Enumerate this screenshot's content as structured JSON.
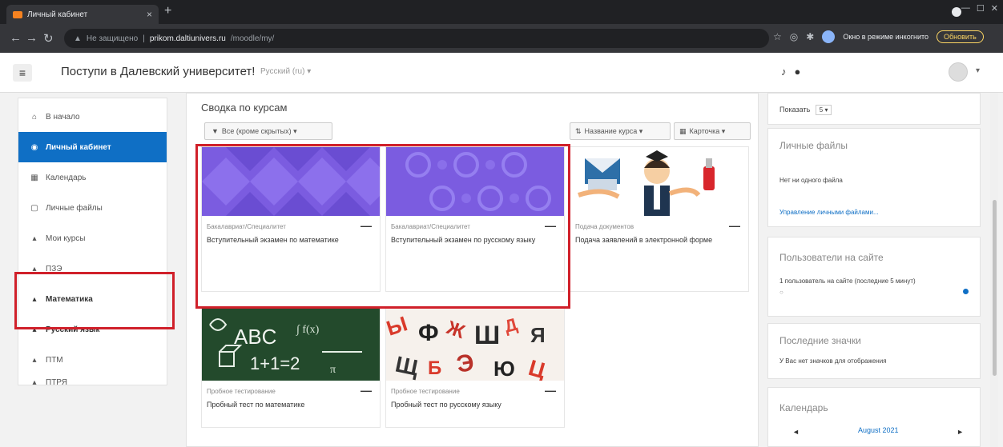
{
  "browser": {
    "tab_title": "Личный кабинет",
    "tab_close": "×",
    "new_tab": "+",
    "insecure_label": "Не защищено",
    "url_host": "prikom.daltiunivers.ru",
    "url_path": "/moodle/my/",
    "update_label": "Обновить",
    "profile_label": "Окно в режиме инкогнито"
  },
  "navbar": {
    "site_name": "Поступи в Далевский университет!",
    "language": "Русский (ru) ▾",
    "menu_glyph": "≡"
  },
  "sidebar": {
    "items": [
      {
        "label": "В начало",
        "icon": "⌂"
      },
      {
        "label": "Личный кабинет",
        "icon": "◉"
      },
      {
        "label": "Календарь",
        "icon": "▦"
      },
      {
        "label": "Личные файлы",
        "icon": "▢"
      },
      {
        "label": "Мои курсы",
        "icon": "▴"
      },
      {
        "label": "ПЗЭ",
        "icon": "▴"
      },
      {
        "label": "Математика",
        "icon": "▴"
      },
      {
        "label": "Русский язык",
        "icon": "▴"
      },
      {
        "label": "ПТМ",
        "icon": "▴"
      },
      {
        "label": "ПТРЯ",
        "icon": "▴"
      }
    ]
  },
  "main": {
    "title": "Сводка по курсам",
    "filter_label": "Все (кроме скрытых) ▾",
    "sort_label": "Название курса ▾",
    "view_label": "Карточка ▾",
    "cards": [
      {
        "category": "Бакалавриат/Специалитет",
        "name": "Вступительный экзамен по математике"
      },
      {
        "category": "Бакалавриат/Специалитет",
        "name": "Вступительный экзамен по русскому языку"
      },
      {
        "category": "Подача документов",
        "name": "Подача заявлений в электронной форме"
      },
      {
        "category": "Пробное тестирование",
        "name": "Пробный тест по математике"
      },
      {
        "category": "Пробное тестирование",
        "name": "Пробный тест по русскому языку"
      }
    ],
    "card_menu": "—"
  },
  "right": {
    "show_label": "Показать",
    "show_value": "5 ▾",
    "files_title": "Личные файлы",
    "files_empty": "Нет ни одного файла",
    "files_manage": "Управление личными файлами...",
    "users_title": "Пользователи на сайте",
    "users_text": "1 пользователь на сайте (последние 5 минут)",
    "badges_title": "Последние значки",
    "badges_text": "У Вас нет значков для отображения",
    "calendar_title": "Календарь",
    "calendar_month": "August 2021",
    "cal_prev": "◄",
    "cal_next": "►"
  },
  "colors": {
    "brand": "#0f6fc5",
    "highlight": "#d0202a",
    "card_purple": "#7b5ce0"
  }
}
